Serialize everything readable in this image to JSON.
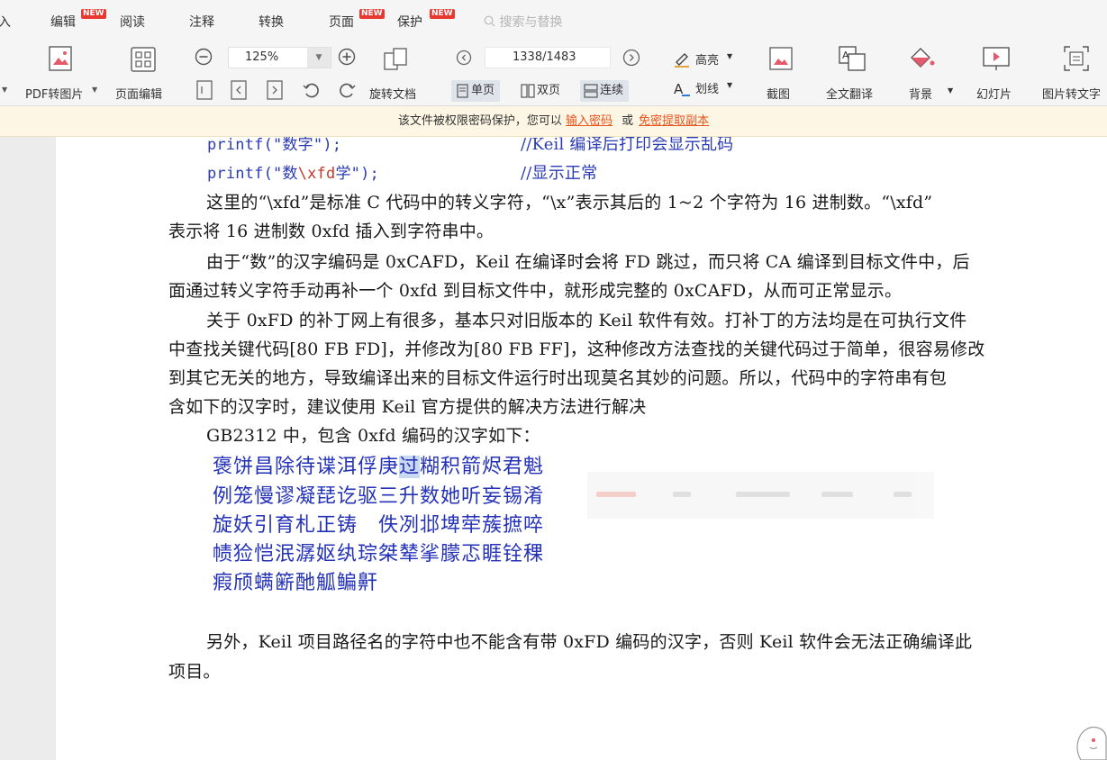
{
  "menu": {
    "tabs": [
      {
        "label": "入",
        "new": false
      },
      {
        "label": "编辑",
        "new": true
      },
      {
        "label": "阅读",
        "new": false
      },
      {
        "label": "注释",
        "new": false
      },
      {
        "label": "转换",
        "new": false
      },
      {
        "label": "页面",
        "new": true
      },
      {
        "label": "保护",
        "new": true
      }
    ],
    "new_badge": "NEW",
    "search_label": "搜索与替换"
  },
  "toolbar": {
    "pdf_to_image": "PDF转图片",
    "page_edit": "页面编辑",
    "zoom_value": "125%",
    "rotate_doc": "旋转文档",
    "page_indicator": "1338/1483",
    "view_single": "单页",
    "view_double": "双页",
    "view_continuous": "连续",
    "highlight": "高亮",
    "strikethrough": "划线",
    "screenshot": "截图",
    "translate": "全文翻译",
    "background": "背景",
    "slideshow": "幻灯片",
    "image_to_text": "图片转文字"
  },
  "notice": {
    "text_before": "该文件被权限密码保护，您可以",
    "link_password": "输入密码",
    "text_or": "或",
    "link_extract": "免密提取副本"
  },
  "doc": {
    "code_line1_fn": "printf(\"数字\");",
    "code_line1_cmt": "//Keil 编译后打印会显示乱码",
    "code_line2_a": "printf(\"数",
    "code_line2_b": "\\xfd",
    "code_line2_c": "学\");",
    "code_line2_cmt": "//显示正常",
    "p1_l1": "这里的“\\xfd”是标准 C 代码中的转义字符，“\\x”表示其后的 1~2 个字符为 16 进制数。“\\xfd”",
    "p1_l2": "表示将 16 进制数 0xfd 插入到字符串中。",
    "p2_l1": "由于“数”的汉字编码是 0xCAFD，Keil 在编译时会将 FD 跳过，而只将 CA 编译到目标文件中，后",
    "p2_l2": "面通过转义字符手动再补一个 0xfd 到目标文件中，就形成完整的 0xCAFD，从而可正常显示。",
    "p3_l1": "关于 0xFD 的补丁网上有很多，基本只对旧版本的 Keil 软件有效。打补丁的方法均是在可执行文件",
    "p3_l2": "中查找关键代码[80 FB FD]，并修改为[80 FB FF]，这种修改方法查找的关键代码过于简单，很容易修改",
    "p3_l3": "到其它无关的地方，导致编译出来的目标文件运行时出现莫名其妙的问题。所以，代码中的字符串有包",
    "p3_l4": "含如下的汉字时，建议使用 Keil 官方提供的解决方法进行解决",
    "gb_intro": "GB2312 中，包含 0xfd 编码的汉字如下：",
    "chars_row1_a": "褒饼昌除待谍洱俘庚",
    "chars_row1_sel": "过",
    "chars_row1_b": "糊积箭烬君魁",
    "chars_row2": "例笼慢谬凝琵讫驱三升数她听妄锡淆",
    "chars_row3": "旋妖引育札正铸　佚冽邶埤荦蔟摭啐",
    "chars_row4": "帻猃恺泯潺妪纨琮桀辇挲朦忑睚铨稞",
    "chars_row5": "瘕颀螨簖酏觚鳊鼾",
    "p4_l1": "另外，Keil 项目路径名的字符中也不能含有带 0xFD 编码的汉字，否则 Keil 软件会无法正确编译此",
    "p4_l2": "项目。"
  },
  "colors": {
    "accent_orange": "#e8541e",
    "new_badge": "#e8382f",
    "code_blue": "#2b3bb5",
    "notice_bg": "#fdf6e5"
  }
}
